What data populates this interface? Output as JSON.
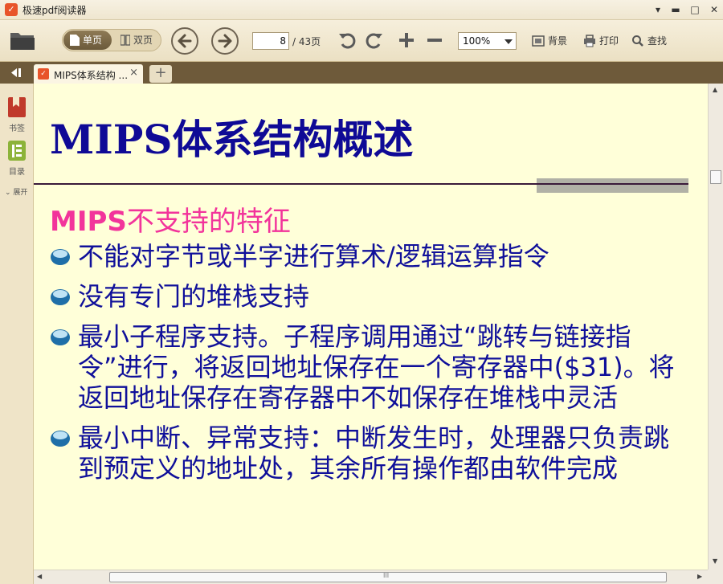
{
  "window": {
    "title": "极速pdf阅读器",
    "minimize": "▬",
    "maximize": "□",
    "close": "✕"
  },
  "toolbar": {
    "single_page_label": "单页",
    "double_page_label": "双页",
    "current_page": "8",
    "total_pages": "/ 43页",
    "zoom": "100%",
    "background_label": "背景",
    "print_label": "打印",
    "find_label": "查找"
  },
  "tabs": [
    {
      "label": "MIPS体系结构 ...",
      "close": "×"
    }
  ],
  "tab_add": "+",
  "sidebar": {
    "bookmark_label": "书签",
    "toc_label": "目录",
    "expand_label": "展开"
  },
  "document": {
    "title": "MIPS体系结构概述",
    "subtitle_bold": "MIPS",
    "subtitle_rest": "不支持的特征",
    "bullets": [
      "不能对字节或半字进行算术/逻辑运算指令",
      "没有专门的堆栈支持",
      "最小子程序支持。子程序调用通过“跳转与链接指令”进行，将返回地址保存在一个寄存器中($31)。将返回地址保存在寄存器中不如保存在堆栈中灵活",
      "最小中断、异常支持：中断发生时，处理器只负责跳到预定义的地址处，其余所有操作都由软件完成"
    ]
  },
  "scrollbar": {
    "grip": "III"
  },
  "colors": {
    "title": "#0f0a96",
    "subtitle": "#f2349b",
    "bullet_text": "#10109a",
    "page_bg": "#ffffd9"
  }
}
